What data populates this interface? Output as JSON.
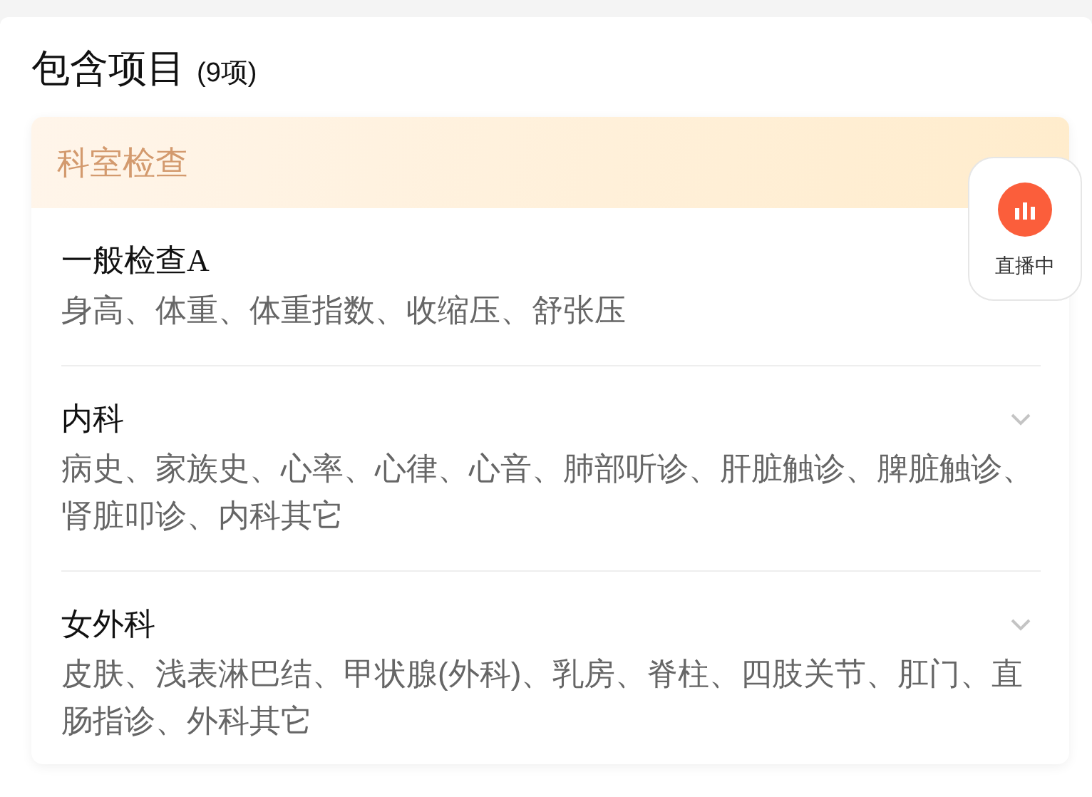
{
  "section": {
    "title": "包含项目",
    "count": "(9项)"
  },
  "category": {
    "title": "科室检查"
  },
  "items": [
    {
      "title": "一般检查A",
      "detail": "身高、体重、体重指数、收缩压、舒张压"
    },
    {
      "title": "内科",
      "detail": "病史、家族史、心率、心律、心音、肺部听诊、肝脏触诊、脾脏触诊、肾脏叩诊、内科其它",
      "chevron": true
    },
    {
      "title": "女外科",
      "detail": "皮肤、浅表淋巴结、甲状腺(外科)、乳房、脊柱、四肢关节、肛门、直肠指诊、外科其它",
      "chevron": true
    }
  ],
  "live_badge": {
    "label": "直播中"
  }
}
